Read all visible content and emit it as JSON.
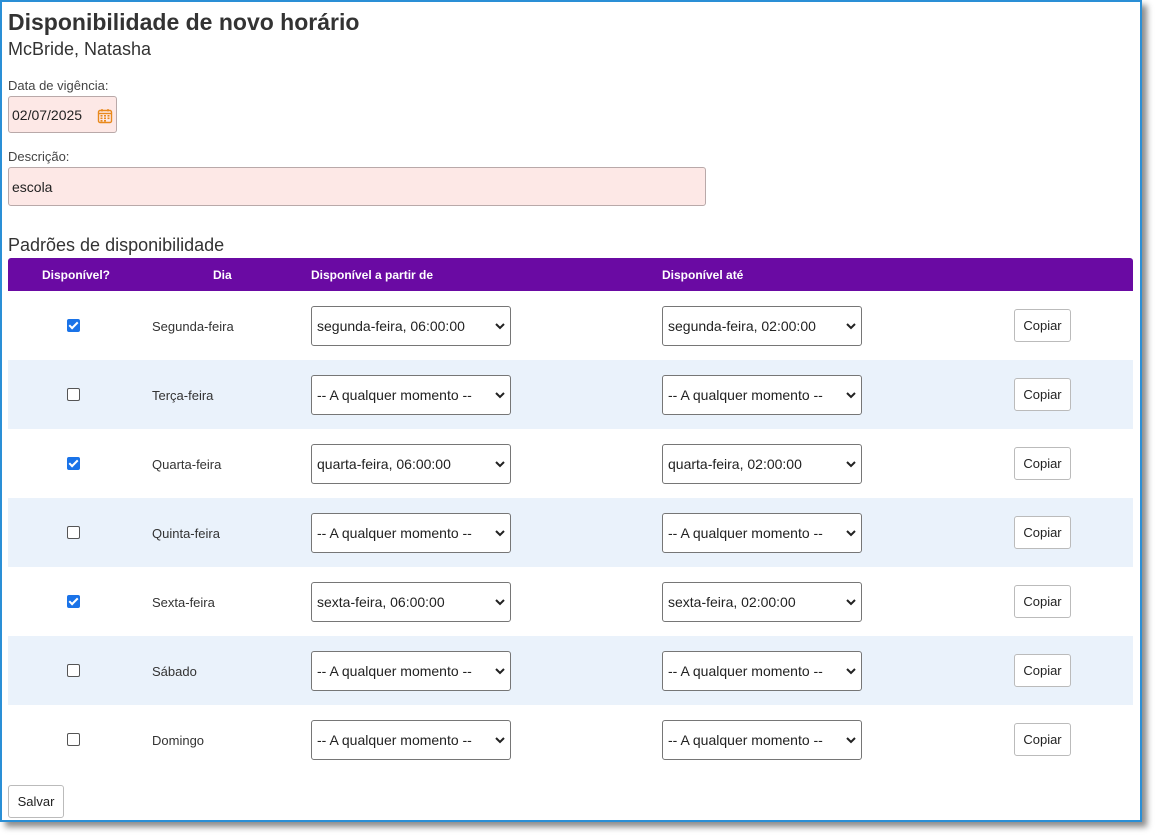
{
  "page": {
    "title": "Disponibilidade de novo horário",
    "employee": "McBride, Natasha"
  },
  "form": {
    "date_label": "Data de vigência:",
    "date_value": "02/07/2025",
    "desc_label": "Descrição:",
    "desc_value": "escola"
  },
  "patterns": {
    "title": "Padrões de disponibilidade",
    "headers": {
      "available": "Disponível?",
      "day": "Dia",
      "from": "Disponível a partir de",
      "to": "Disponível até"
    },
    "copy_label": "Copiar",
    "rows": [
      {
        "checked": true,
        "day": "Segunda-feira",
        "from": "segunda-feira, 06:00:00",
        "to": "segunda-feira, 02:00:00"
      },
      {
        "checked": false,
        "day": "Terça-feira",
        "from": "-- A qualquer momento --",
        "to": "-- A qualquer momento --"
      },
      {
        "checked": true,
        "day": "Quarta-feira",
        "from": "quarta-feira, 06:00:00",
        "to": "quarta-feira, 02:00:00"
      },
      {
        "checked": false,
        "day": "Quinta-feira",
        "from": "-- A qualquer momento --",
        "to": "-- A qualquer momento --"
      },
      {
        "checked": true,
        "day": "Sexta-feira",
        "from": "sexta-feira, 06:00:00",
        "to": "sexta-feira, 02:00:00"
      },
      {
        "checked": false,
        "day": "Sábado",
        "from": "-- A qualquer momento --",
        "to": "-- A qualquer momento --"
      },
      {
        "checked": false,
        "day": "Domingo",
        "from": "-- A qualquer momento --",
        "to": "-- A qualquer momento --"
      }
    ]
  },
  "actions": {
    "save_label": "Salvar"
  },
  "colors": {
    "header_bg": "#6a0aa3",
    "alt_row_bg": "#eaf2fb",
    "required_field_bg": "#fde8e6",
    "checkbox_checked": "#1a73e8",
    "frame_border": "#2a8fd6",
    "calendar_icon": "#e8891c"
  }
}
